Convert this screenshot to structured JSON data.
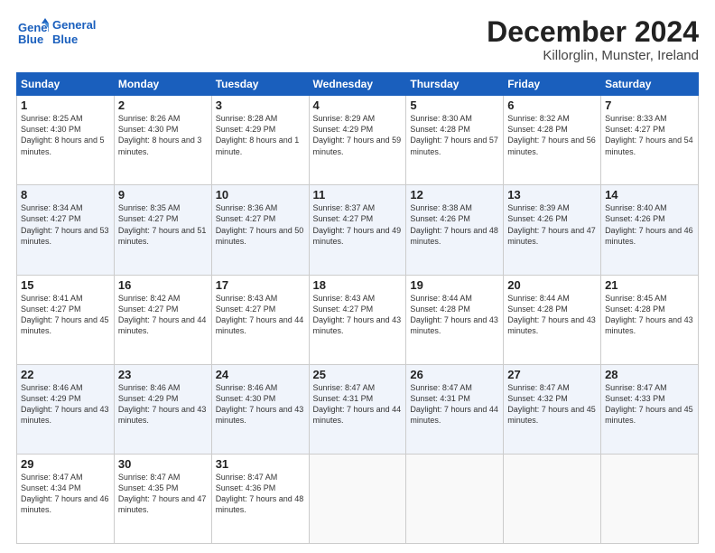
{
  "header": {
    "logo_line1": "General",
    "logo_line2": "Blue",
    "title": "December 2024",
    "subtitle": "Killorglin, Munster, Ireland"
  },
  "weekdays": [
    "Sunday",
    "Monday",
    "Tuesday",
    "Wednesday",
    "Thursday",
    "Friday",
    "Saturday"
  ],
  "weeks": [
    [
      {
        "day": "1",
        "rise": "Sunrise: 8:25 AM",
        "set": "Sunset: 4:30 PM",
        "daylight": "Daylight: 8 hours and 5 minutes."
      },
      {
        "day": "2",
        "rise": "Sunrise: 8:26 AM",
        "set": "Sunset: 4:30 PM",
        "daylight": "Daylight: 8 hours and 3 minutes."
      },
      {
        "day": "3",
        "rise": "Sunrise: 8:28 AM",
        "set": "Sunset: 4:29 PM",
        "daylight": "Daylight: 8 hours and 1 minute."
      },
      {
        "day": "4",
        "rise": "Sunrise: 8:29 AM",
        "set": "Sunset: 4:29 PM",
        "daylight": "Daylight: 7 hours and 59 minutes."
      },
      {
        "day": "5",
        "rise": "Sunrise: 8:30 AM",
        "set": "Sunset: 4:28 PM",
        "daylight": "Daylight: 7 hours and 57 minutes."
      },
      {
        "day": "6",
        "rise": "Sunrise: 8:32 AM",
        "set": "Sunset: 4:28 PM",
        "daylight": "Daylight: 7 hours and 56 minutes."
      },
      {
        "day": "7",
        "rise": "Sunrise: 8:33 AM",
        "set": "Sunset: 4:27 PM",
        "daylight": "Daylight: 7 hours and 54 minutes."
      }
    ],
    [
      {
        "day": "8",
        "rise": "Sunrise: 8:34 AM",
        "set": "Sunset: 4:27 PM",
        "daylight": "Daylight: 7 hours and 53 minutes."
      },
      {
        "day": "9",
        "rise": "Sunrise: 8:35 AM",
        "set": "Sunset: 4:27 PM",
        "daylight": "Daylight: 7 hours and 51 minutes."
      },
      {
        "day": "10",
        "rise": "Sunrise: 8:36 AM",
        "set": "Sunset: 4:27 PM",
        "daylight": "Daylight: 7 hours and 50 minutes."
      },
      {
        "day": "11",
        "rise": "Sunrise: 8:37 AM",
        "set": "Sunset: 4:27 PM",
        "daylight": "Daylight: 7 hours and 49 minutes."
      },
      {
        "day": "12",
        "rise": "Sunrise: 8:38 AM",
        "set": "Sunset: 4:26 PM",
        "daylight": "Daylight: 7 hours and 48 minutes."
      },
      {
        "day": "13",
        "rise": "Sunrise: 8:39 AM",
        "set": "Sunset: 4:26 PM",
        "daylight": "Daylight: 7 hours and 47 minutes."
      },
      {
        "day": "14",
        "rise": "Sunrise: 8:40 AM",
        "set": "Sunset: 4:26 PM",
        "daylight": "Daylight: 7 hours and 46 minutes."
      }
    ],
    [
      {
        "day": "15",
        "rise": "Sunrise: 8:41 AM",
        "set": "Sunset: 4:27 PM",
        "daylight": "Daylight: 7 hours and 45 minutes."
      },
      {
        "day": "16",
        "rise": "Sunrise: 8:42 AM",
        "set": "Sunset: 4:27 PM",
        "daylight": "Daylight: 7 hours and 44 minutes."
      },
      {
        "day": "17",
        "rise": "Sunrise: 8:43 AM",
        "set": "Sunset: 4:27 PM",
        "daylight": "Daylight: 7 hours and 44 minutes."
      },
      {
        "day": "18",
        "rise": "Sunrise: 8:43 AM",
        "set": "Sunset: 4:27 PM",
        "daylight": "Daylight: 7 hours and 43 minutes."
      },
      {
        "day": "19",
        "rise": "Sunrise: 8:44 AM",
        "set": "Sunset: 4:28 PM",
        "daylight": "Daylight: 7 hours and 43 minutes."
      },
      {
        "day": "20",
        "rise": "Sunrise: 8:44 AM",
        "set": "Sunset: 4:28 PM",
        "daylight": "Daylight: 7 hours and 43 minutes."
      },
      {
        "day": "21",
        "rise": "Sunrise: 8:45 AM",
        "set": "Sunset: 4:28 PM",
        "daylight": "Daylight: 7 hours and 43 minutes."
      }
    ],
    [
      {
        "day": "22",
        "rise": "Sunrise: 8:46 AM",
        "set": "Sunset: 4:29 PM",
        "daylight": "Daylight: 7 hours and 43 minutes."
      },
      {
        "day": "23",
        "rise": "Sunrise: 8:46 AM",
        "set": "Sunset: 4:29 PM",
        "daylight": "Daylight: 7 hours and 43 minutes."
      },
      {
        "day": "24",
        "rise": "Sunrise: 8:46 AM",
        "set": "Sunset: 4:30 PM",
        "daylight": "Daylight: 7 hours and 43 minutes."
      },
      {
        "day": "25",
        "rise": "Sunrise: 8:47 AM",
        "set": "Sunset: 4:31 PM",
        "daylight": "Daylight: 7 hours and 44 minutes."
      },
      {
        "day": "26",
        "rise": "Sunrise: 8:47 AM",
        "set": "Sunset: 4:31 PM",
        "daylight": "Daylight: 7 hours and 44 minutes."
      },
      {
        "day": "27",
        "rise": "Sunrise: 8:47 AM",
        "set": "Sunset: 4:32 PM",
        "daylight": "Daylight: 7 hours and 45 minutes."
      },
      {
        "day": "28",
        "rise": "Sunrise: 8:47 AM",
        "set": "Sunset: 4:33 PM",
        "daylight": "Daylight: 7 hours and 45 minutes."
      }
    ],
    [
      {
        "day": "29",
        "rise": "Sunrise: 8:47 AM",
        "set": "Sunset: 4:34 PM",
        "daylight": "Daylight: 7 hours and 46 minutes."
      },
      {
        "day": "30",
        "rise": "Sunrise: 8:47 AM",
        "set": "Sunset: 4:35 PM",
        "daylight": "Daylight: 7 hours and 47 minutes."
      },
      {
        "day": "31",
        "rise": "Sunrise: 8:47 AM",
        "set": "Sunset: 4:36 PM",
        "daylight": "Daylight: 7 hours and 48 minutes."
      },
      null,
      null,
      null,
      null
    ]
  ]
}
